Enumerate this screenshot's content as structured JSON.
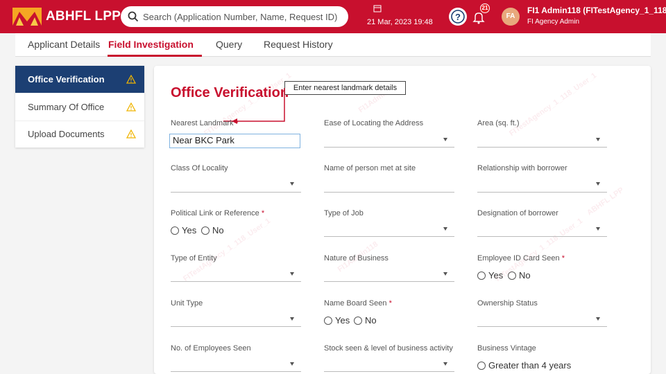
{
  "header": {
    "brand": "ABHFL LPP",
    "search_placeholder": "Search (Application Number, Name, Request ID)",
    "datetime": "21 Mar, 2023 19:48",
    "notification_count": "21",
    "avatar_initials": "FA",
    "user_name": "FI1 Admin118 (FITestAgency_1_118_Use",
    "user_role": "FI Agency Admin"
  },
  "tabs": [
    "Applicant Details",
    "Field Investigation",
    "Query",
    "Request History"
  ],
  "sidebar": {
    "items": [
      {
        "label": "Office Verification"
      },
      {
        "label": "Summary Of Office"
      },
      {
        "label": "Upload Documents"
      }
    ]
  },
  "form": {
    "title": "Office Verification",
    "callout": "Enter nearest landmark details",
    "required_mark": "*",
    "fields": {
      "nearest_landmark": {
        "label": "Nearest Landmark",
        "value": "Near BKC Park"
      },
      "ease_locating": {
        "label": "Ease of Locating the Address"
      },
      "area": {
        "label": "Area (sq. ft.)"
      },
      "class_locality": {
        "label": "Class Of Locality"
      },
      "person_met": {
        "label": "Name of person met at site"
      },
      "relationship": {
        "label": "Relationship with borrower"
      },
      "political_link": {
        "label": "Political Link or Reference",
        "options": [
          "Yes",
          "No"
        ]
      },
      "type_job": {
        "label": "Type of Job"
      },
      "designation": {
        "label": "Designation of borrower"
      },
      "type_entity": {
        "label": "Type of Entity"
      },
      "nature_business": {
        "label": "Nature of Business"
      },
      "employee_id": {
        "label": "Employee ID Card Seen",
        "options": [
          "Yes",
          "No"
        ]
      },
      "unit_type": {
        "label": "Unit Type"
      },
      "name_board": {
        "label": "Name Board Seen",
        "options": [
          "Yes",
          "No"
        ]
      },
      "ownership": {
        "label": "Ownership Status"
      },
      "employees_seen": {
        "label": "No. of Employees Seen"
      },
      "stock_seen": {
        "label": "Stock seen & level of business activity"
      },
      "business_vintage": {
        "label": "Business Vintage",
        "option": "Greater than 4 years"
      }
    }
  },
  "watermark": {
    "agency": "FITestAgency_1_118_User_1",
    "admin": "FI1Admin118",
    "brand": "ABHFL LPP"
  },
  "colors": {
    "brand_red": "#c8102e",
    "sidebar_active": "#1c3f73",
    "warning": "#f0b400"
  }
}
